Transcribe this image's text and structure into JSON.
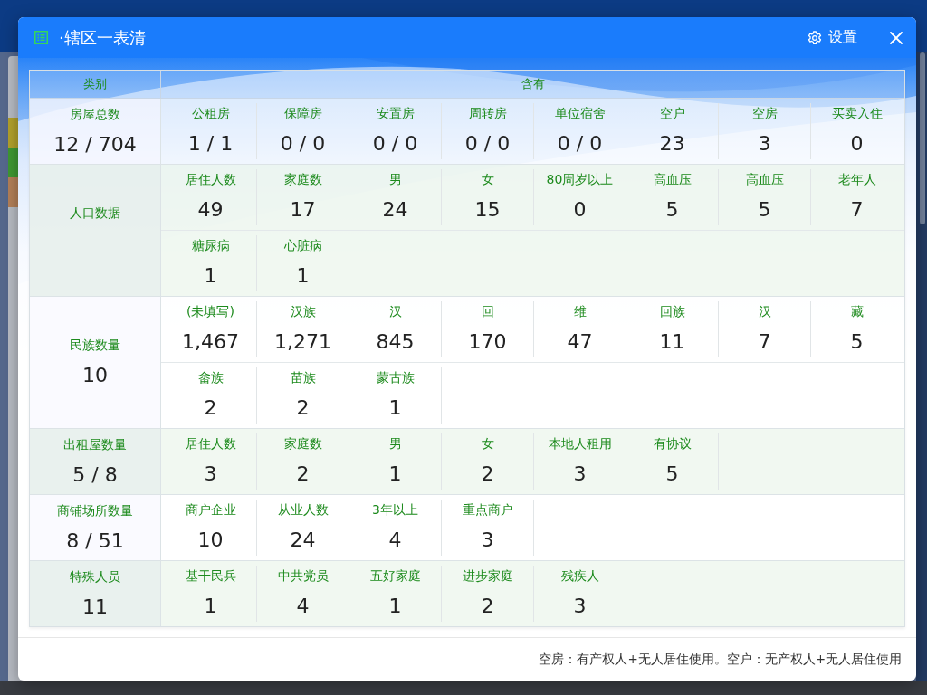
{
  "window": {
    "title": "·辖区一表清",
    "settings_label": "设置"
  },
  "table": {
    "columns": [
      "类别",
      "含有"
    ],
    "rows": [
      {
        "category": "房屋总数",
        "value": "12 / 704",
        "items": [
          {
            "label": "公租房",
            "value": "1 / 1"
          },
          {
            "label": "保障房",
            "value": "0 / 0"
          },
          {
            "label": "安置房",
            "value": "0 / 0"
          },
          {
            "label": "周转房",
            "value": "0 / 0"
          },
          {
            "label": "单位宿舍",
            "value": "0 / 0"
          },
          {
            "label": "空户",
            "value": "23"
          },
          {
            "label": "空房",
            "value": "3"
          },
          {
            "label": "买卖入住",
            "value": "0"
          }
        ]
      },
      {
        "category": "人口数据",
        "items": [
          {
            "label": "居住人数",
            "value": "49"
          },
          {
            "label": "家庭数",
            "value": "17"
          },
          {
            "label": "男",
            "value": "24"
          },
          {
            "label": "女",
            "value": "15"
          },
          {
            "label": "80周岁以上",
            "value": "0"
          },
          {
            "label": "高血压",
            "value": "5"
          },
          {
            "label": "高血压",
            "value": "5"
          },
          {
            "label": "老年人",
            "value": "7"
          },
          {
            "label": "糖尿病",
            "value": "1"
          },
          {
            "label": "心脏病",
            "value": "1"
          }
        ]
      },
      {
        "category": "民族数量",
        "value": "10",
        "items": [
          {
            "label": "(未填写)",
            "value": "1,467"
          },
          {
            "label": "汉族",
            "value": "1,271"
          },
          {
            "label": "汉",
            "value": "845"
          },
          {
            "label": "回",
            "value": "170"
          },
          {
            "label": "维",
            "value": "47"
          },
          {
            "label": "回族",
            "value": "11"
          },
          {
            "label": "汉",
            "value": "7"
          },
          {
            "label": "藏",
            "value": "5"
          },
          {
            "label": "畲族",
            "value": "2"
          },
          {
            "label": "苗族",
            "value": "2"
          },
          {
            "label": "蒙古族",
            "value": "1"
          }
        ]
      },
      {
        "category": "出租屋数量",
        "value": "5 / 8",
        "items": [
          {
            "label": "居住人数",
            "value": "3"
          },
          {
            "label": "家庭数",
            "value": "2"
          },
          {
            "label": "男",
            "value": "1"
          },
          {
            "label": "女",
            "value": "2"
          },
          {
            "label": "本地人租用",
            "value": "3"
          },
          {
            "label": "有协议",
            "value": "5"
          }
        ]
      },
      {
        "category": "商铺场所数量",
        "value": "8 / 51",
        "items": [
          {
            "label": "商户企业",
            "value": "10"
          },
          {
            "label": "从业人数",
            "value": "24"
          },
          {
            "label": "3年以上",
            "value": "4"
          },
          {
            "label": "重点商户",
            "value": "3"
          }
        ]
      },
      {
        "category": "特殊人员",
        "value": "11",
        "items": [
          {
            "label": "基干民兵",
            "value": "1"
          },
          {
            "label": "中共党员",
            "value": "4"
          },
          {
            "label": "五好家庭",
            "value": "1"
          },
          {
            "label": "进步家庭",
            "value": "2"
          },
          {
            "label": "残疾人",
            "value": "3"
          }
        ]
      }
    ]
  },
  "footer_note": "空房：有产权人+无人居住使用。空户：无产权人+无人居住使用"
}
